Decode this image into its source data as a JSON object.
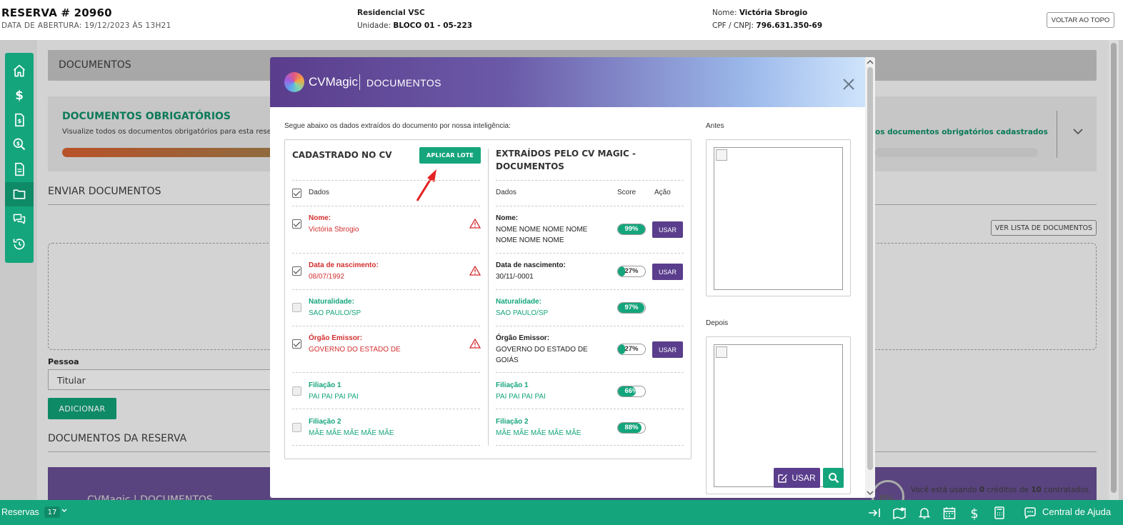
{
  "header": {
    "reservation_title": "RESERVA # 20960",
    "opened_at": "DATA DE ABERTURA: 19/12/2023 ÀS 13H21",
    "enterprise": "Residencial VSC",
    "unit_label": "Unidade:",
    "unit_value": "BLOCO 01 - 05-223",
    "client_name_label": "Nome:",
    "client_name_value": "Victória Sbrogio",
    "client_doc_label": "CPF / CNPJ:",
    "client_doc_value": "796.631.350-69",
    "back_to_top": "VOLTAR AO TOPO"
  },
  "sidenav": {
    "items": [
      "home-icon",
      "dollar-icon",
      "invoice-icon",
      "search-doc-icon",
      "document-icon",
      "folder-icon",
      "chat-icon",
      "history-icon"
    ],
    "active_index": 5
  },
  "background": {
    "section_title": "DOCUMENTOS",
    "required_title": "DOCUMENTOS OBRIGATÓRIOS",
    "required_subtitle": "Visualize todos os documentos obrigatórios para esta rese",
    "required_link": "os documentos obrigatórios cadastrados",
    "send_title": "ENVIAR DOCUMENTOS",
    "list_button": "VER LISTA DE DOCUMENTOS",
    "person_label": "Pessoa",
    "person_value": "Titular",
    "add_button": "ADICIONAR",
    "reservation_docs_title": "DOCUMENTOS DA RESERVA",
    "band_label": "CVMagic | DOCUMENTOS",
    "credit_percent": "0%",
    "credit_prefix": "Você está usando ",
    "credit_used": "0",
    "credit_middle": " créditos de ",
    "credit_total": "10",
    "credit_suffix": " contratados."
  },
  "modal": {
    "brand": "CVMagic",
    "title": "DOCUMENTOS",
    "intro": "Segue abaixo os dados extraídos do documento por nossa inteligência:",
    "left_title": "CADASTRADO NO CV",
    "apply_button": "APLICAR LOTE",
    "right_title_line1": "EXTRAÍDOS PELO CV MAGIC -",
    "right_title_line2": "DOCUMENTOS",
    "col_data": "Dados",
    "col_score": "Score",
    "col_action": "Ação",
    "use_label": "USAR",
    "fields": [
      {
        "label": "Nome:",
        "cv_value": "Victória Sbrogio",
        "status": "mismatch",
        "checked": true,
        "magic_label": "Nome:",
        "magic_value": "NOME NOME NOME NOME NOME NOME NOME",
        "score": 99,
        "has_use": true
      },
      {
        "label": "Data de nascimento:",
        "cv_value": "08/07/1992",
        "status": "mismatch",
        "checked": true,
        "magic_label": "Data de nascimento:",
        "magic_value": "30/11/-0001",
        "score": 27,
        "has_use": true
      },
      {
        "label": "Naturalidade:",
        "cv_value": "SAO PAULO/SP",
        "status": "match",
        "checked": false,
        "magic_label": "Naturalidade:",
        "magic_value": "SAO PAULO/SP",
        "score": 97,
        "has_use": false
      },
      {
        "label": "Órgão Emissor:",
        "cv_value": "GOVERNO DO ESTADO DE",
        "status": "mismatch",
        "checked": true,
        "magic_label": "Órgão Emissor:",
        "magic_value": "GOVERNO DO ESTADO DE GOIÁS",
        "score": 27,
        "has_use": true
      },
      {
        "label": "Filiação 1",
        "cv_value": "PAI PAI PAI PAI",
        "status": "match",
        "checked": false,
        "magic_label": "Filiação 1",
        "magic_value": "PAI PAI PAI PAI",
        "score": 66,
        "has_use": false
      },
      {
        "label": "Filiação 2",
        "cv_value": "MÃE MÃE MÃE MÃE MÃE",
        "status": "match",
        "checked": false,
        "magic_label": "Filiação 2",
        "magic_value": "MÃE MÃE MÃE MÃE MÃE",
        "score": 88,
        "has_use": false
      }
    ],
    "before_label": "Antes",
    "after_label": "Depois",
    "image_use_button": "USAR"
  },
  "bottombar": {
    "reservations_label": "Reservas",
    "reservations_count": "17",
    "help_label": "Central de Ajuda"
  },
  "colors": {
    "green": "#14a57c",
    "purple": "#5a3d8c",
    "red": "#d32f2f"
  }
}
